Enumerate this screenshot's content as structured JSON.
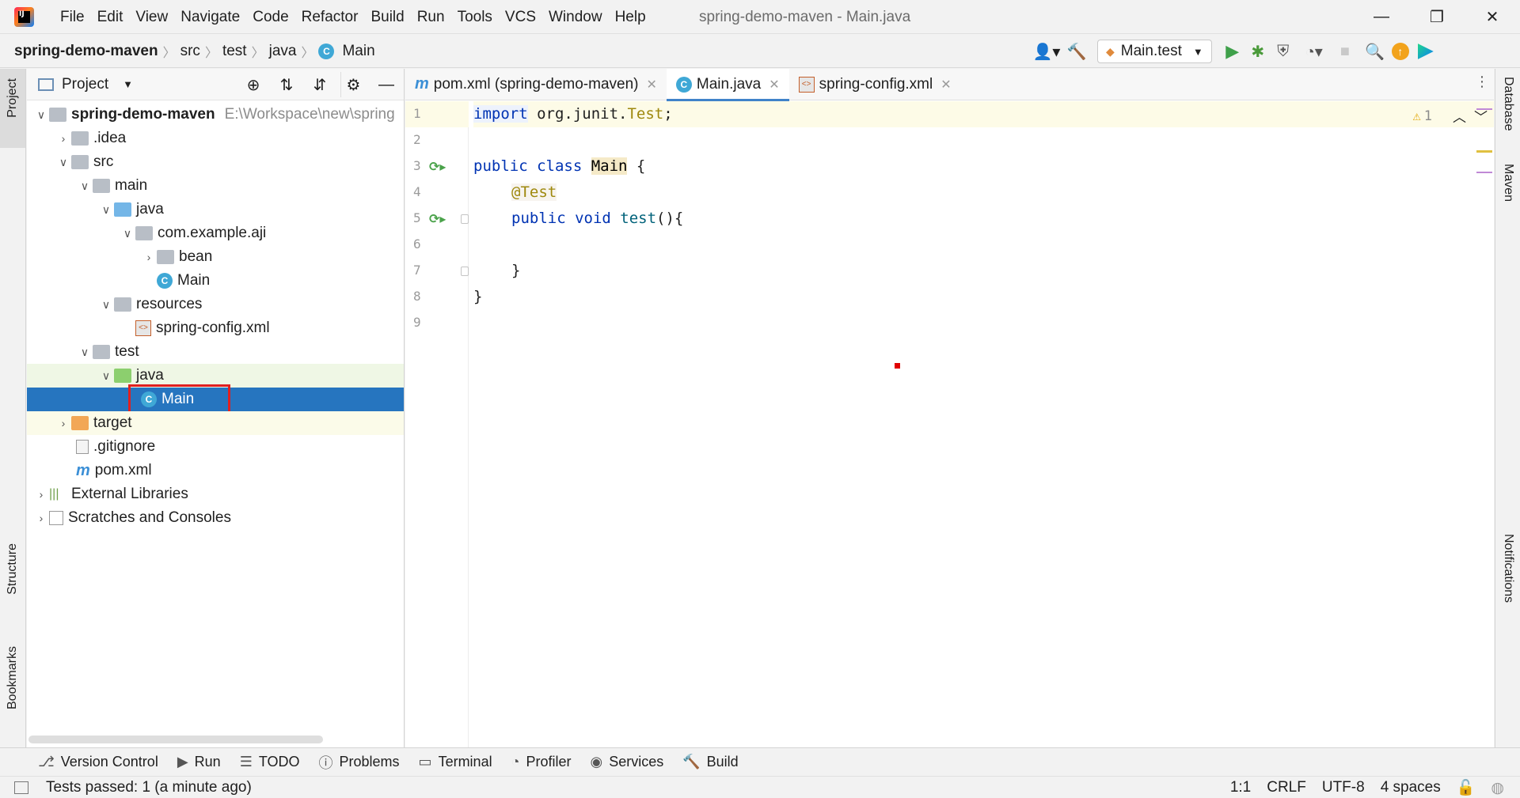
{
  "window": {
    "title": "spring-demo-maven - Main.java",
    "minimize_glyph": "—",
    "restore_glyph": "❐",
    "close_glyph": "✕"
  },
  "menu": [
    "File",
    "Edit",
    "View",
    "Navigate",
    "Code",
    "Refactor",
    "Build",
    "Run",
    "Tools",
    "VCS",
    "Window",
    "Help"
  ],
  "breadcrumb": [
    "spring-demo-maven",
    "src",
    "test",
    "java",
    "Main"
  ],
  "toolbar": {
    "run_config": "Main.test",
    "icons": [
      "user-icon",
      "hammer-icon",
      "run-icon",
      "debug-icon",
      "coverage-icon",
      "profile-icon",
      "stop-icon",
      "search-icon",
      "update-icon",
      "jetbrains-icon"
    ]
  },
  "left_strip": {
    "project": "Project",
    "structure": "Structure",
    "bookmarks": "Bookmarks"
  },
  "right_strip": {
    "database": "Database",
    "maven": "Maven",
    "notifications": "Notifications"
  },
  "project_panel": {
    "title": "Project",
    "root_path": "E:\\Workspace\\new\\spring",
    "tree": [
      {
        "label": "spring-demo-maven",
        "icon": "module-folder",
        "depth": 0,
        "expanded": true
      },
      {
        "label": ".idea",
        "icon": "folder",
        "depth": 1,
        "expanded": false
      },
      {
        "label": "src",
        "icon": "folder",
        "depth": 1,
        "expanded": true
      },
      {
        "label": "main",
        "icon": "folder",
        "depth": 2,
        "expanded": true
      },
      {
        "label": "java",
        "icon": "source-folder",
        "depth": 3,
        "expanded": true
      },
      {
        "label": "com.example.aji",
        "icon": "package",
        "depth": 4,
        "expanded": true
      },
      {
        "label": "bean",
        "icon": "package",
        "depth": 5,
        "expanded": false
      },
      {
        "label": "Main",
        "icon": "class",
        "depth": 5
      },
      {
        "label": "resources",
        "icon": "resources-folder",
        "depth": 3,
        "expanded": true
      },
      {
        "label": "spring-config.xml",
        "icon": "spring-xml",
        "depth": 4
      },
      {
        "label": "test",
        "icon": "folder",
        "depth": 2,
        "expanded": true
      },
      {
        "label": "java",
        "icon": "test-source-folder",
        "depth": 3,
        "expanded": true
      },
      {
        "label": "Main",
        "icon": "class",
        "depth": 4,
        "selected": true
      },
      {
        "label": "target",
        "icon": "excluded-folder",
        "depth": 1,
        "expanded": false
      },
      {
        "label": ".gitignore",
        "icon": "ignored-file",
        "depth": 1
      },
      {
        "label": "pom.xml",
        "icon": "maven",
        "depth": 1
      },
      {
        "label": "External Libraries",
        "icon": "libraries",
        "depth": 0,
        "expanded": false
      },
      {
        "label": "Scratches and Consoles",
        "icon": "scratches",
        "depth": 0,
        "expanded": false
      }
    ]
  },
  "editor": {
    "tabs": [
      {
        "label": "pom.xml (spring-demo-maven)",
        "icon": "maven",
        "active": false
      },
      {
        "label": "Main.java",
        "icon": "class",
        "active": true
      },
      {
        "label": "spring-config.xml",
        "icon": "spring-xml",
        "active": false
      }
    ],
    "warning_count": "1",
    "lines": [
      {
        "n": "1"
      },
      {
        "n": "2"
      },
      {
        "n": "3"
      },
      {
        "n": "4"
      },
      {
        "n": "5"
      },
      {
        "n": "6"
      },
      {
        "n": "7"
      },
      {
        "n": "8"
      },
      {
        "n": "9"
      }
    ],
    "code": {
      "l1_kw": "import",
      "l1_pkg": " org.junit.",
      "l1_cls": "Test",
      "l1_end": ";",
      "l3_kw": "public class ",
      "l3_name": "Main",
      "l3_end": " {",
      "l4_ann": "@Test",
      "l5_kw": "public void ",
      "l5_name": "test",
      "l5_end": "(){",
      "l7": "}",
      "l8": "}"
    }
  },
  "bottom_tools": [
    {
      "label": "Version Control",
      "icon": "vcs-icon"
    },
    {
      "label": "Run",
      "icon": "run-icon"
    },
    {
      "label": "TODO",
      "icon": "todo-icon"
    },
    {
      "label": "Problems",
      "icon": "problems-icon"
    },
    {
      "label": "Terminal",
      "icon": "terminal-icon"
    },
    {
      "label": "Profiler",
      "icon": "profiler-icon"
    },
    {
      "label": "Services",
      "icon": "services-icon"
    },
    {
      "label": "Build",
      "icon": "build-icon"
    }
  ],
  "status": {
    "message": "Tests passed: 1 (a minute ago)",
    "position": "1:1",
    "line_sep": "CRLF",
    "encoding": "UTF-8",
    "indent": "4 spaces"
  },
  "colors": {
    "selection": "#2675bf",
    "highlight_box": "#e02020",
    "keyword": "#0033b3",
    "annotation": "#9e880d",
    "accent": "#4083c9"
  }
}
